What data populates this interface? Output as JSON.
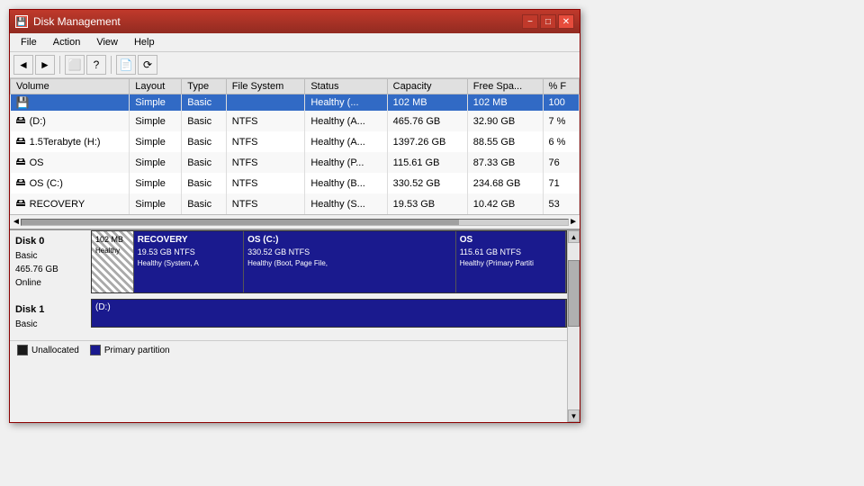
{
  "window": {
    "title": "Disk Management",
    "icon": "💾"
  },
  "title_buttons": {
    "minimize": "−",
    "maximize": "□",
    "close": "✕"
  },
  "menu": {
    "items": [
      "File",
      "Action",
      "View",
      "Help"
    ]
  },
  "toolbar": {
    "buttons": [
      "←",
      "→",
      "⬜",
      "?",
      "⬜",
      "📄",
      "⬜"
    ]
  },
  "table": {
    "columns": [
      "Volume",
      "Layout",
      "Type",
      "File System",
      "Status",
      "Capacity",
      "Free Spa...",
      "% F"
    ],
    "rows": [
      {
        "volume": "",
        "layout": "Simple",
        "type": "Basic",
        "fs": "",
        "status": "Healthy (...",
        "capacity": "102 MB",
        "free": "102 MB",
        "pct": "100",
        "icon": "blue"
      },
      {
        "volume": "(D:)",
        "layout": "Simple",
        "type": "Basic",
        "fs": "NTFS",
        "status": "Healthy (A...",
        "capacity": "465.76 GB",
        "free": "32.90 GB",
        "pct": "7 %",
        "icon": "drive"
      },
      {
        "volume": "1.5Terabyte (H:)",
        "layout": "Simple",
        "type": "Basic",
        "fs": "NTFS",
        "status": "Healthy (A...",
        "capacity": "1397.26 GB",
        "free": "88.55 GB",
        "pct": "6 %",
        "icon": "drive"
      },
      {
        "volume": "OS",
        "layout": "Simple",
        "type": "Basic",
        "fs": "NTFS",
        "status": "Healthy (P...",
        "capacity": "115.61 GB",
        "free": "87.33 GB",
        "pct": "76",
        "icon": "drive"
      },
      {
        "volume": "OS (C:)",
        "layout": "Simple",
        "type": "Basic",
        "fs": "NTFS",
        "status": "Healthy (B...",
        "capacity": "330.52 GB",
        "free": "234.68 GB",
        "pct": "71",
        "icon": "drive"
      },
      {
        "volume": "RECOVERY",
        "layout": "Simple",
        "type": "Basic",
        "fs": "NTFS",
        "status": "Healthy (S...",
        "capacity": "19.53 GB",
        "free": "10.42 GB",
        "pct": "53",
        "icon": "drive"
      }
    ]
  },
  "disks": [
    {
      "name": "Disk 0",
      "type": "Basic",
      "size": "465.76 GB",
      "status": "Online",
      "segments": [
        {
          "label": "",
          "size": "102 MB",
          "sub": "Healthy",
          "type": "hatched",
          "flex": 1
        },
        {
          "label": "RECOVERY",
          "size": "19.53 GB NTFS",
          "sub": "Healthy (System, A",
          "type": "blue",
          "flex": 3
        },
        {
          "label": "OS (C:)",
          "size": "330.52 GB NTFS",
          "sub": "Healthy (Boot, Page File,",
          "type": "blue",
          "flex": 6
        },
        {
          "label": "OS",
          "size": "115.61 GB NTFS",
          "sub": "Healthy (Primary Partiti",
          "type": "blue",
          "flex": 3
        }
      ]
    },
    {
      "name": "Disk 1",
      "type": "Basic",
      "segments": [
        {
          "label": "(D:)",
          "size": "",
          "sub": "",
          "type": "blue",
          "flex": 1
        }
      ]
    }
  ],
  "legend": [
    {
      "label": "Unallocated",
      "color": "#1a1a1a"
    },
    {
      "label": "Primary partition",
      "color": "#1a1a8e"
    }
  ]
}
